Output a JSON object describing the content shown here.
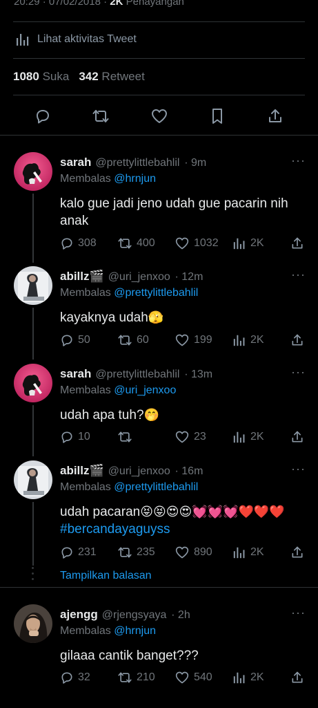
{
  "top": {
    "time": "20:29 · 07/02/2018 ·",
    "views_count": "2K",
    "views_label": "Penayangan",
    "activity_label": "Lihat aktivitas Tweet",
    "likes_count": "1080",
    "likes_label": "Suka",
    "retweets_count": "342",
    "retweets_label": "Retweet"
  },
  "replying_prefix": "Membalas",
  "show_replies": "Tampilkan balasan",
  "more": "···",
  "tweets": [
    {
      "name": "sarah",
      "handle": "@prettylittlebahlil",
      "time": "· 9m",
      "reply_to": "@hrnjun",
      "text": "kalo gue jadi jeno udah gue pacarin nih anak",
      "emoji": "",
      "replies": "308",
      "retweets": "400",
      "likes": "1032",
      "views": "2K"
    },
    {
      "name": "abillz🎬",
      "handle": "@uri_jenxoo",
      "time": "· 12m",
      "reply_to": "@prettylittlebahlil",
      "text": "kayaknya udah",
      "emoji": "🫣",
      "replies": "50",
      "retweets": "60",
      "likes": "199",
      "views": "2K"
    },
    {
      "name": "sarah",
      "handle": "@prettylittlebahlil",
      "time": "· 13m",
      "reply_to": "@uri_jenxoo",
      "text": "udah apa tuh?",
      "emoji": "🤭",
      "replies": "10",
      "retweets": "",
      "likes": "23",
      "views": "2K"
    },
    {
      "name": "abillz🎬",
      "handle": "@uri_jenxoo",
      "time": "· 16m",
      "reply_to": "@prettylittlebahlil",
      "text": "udah pacaran",
      "emoji": "😝😝😍😍💓💓💓❤️❤️❤️",
      "hashtag": "#bercandayaguyss",
      "replies": "231",
      "retweets": "235",
      "likes": "890",
      "views": "2K"
    },
    {
      "name": "ajengg",
      "handle": "@rjengsyaya",
      "time": "· 2h",
      "reply_to": "@hrnjun",
      "text": "gilaaa cantik banget???",
      "emoji": "",
      "replies": "32",
      "retweets": "210",
      "likes": "540",
      "views": "2K"
    }
  ],
  "colors": {
    "accent": "#1d9bf0",
    "muted": "#71767b",
    "text": "#e7e9ea",
    "bg": "#000000"
  }
}
